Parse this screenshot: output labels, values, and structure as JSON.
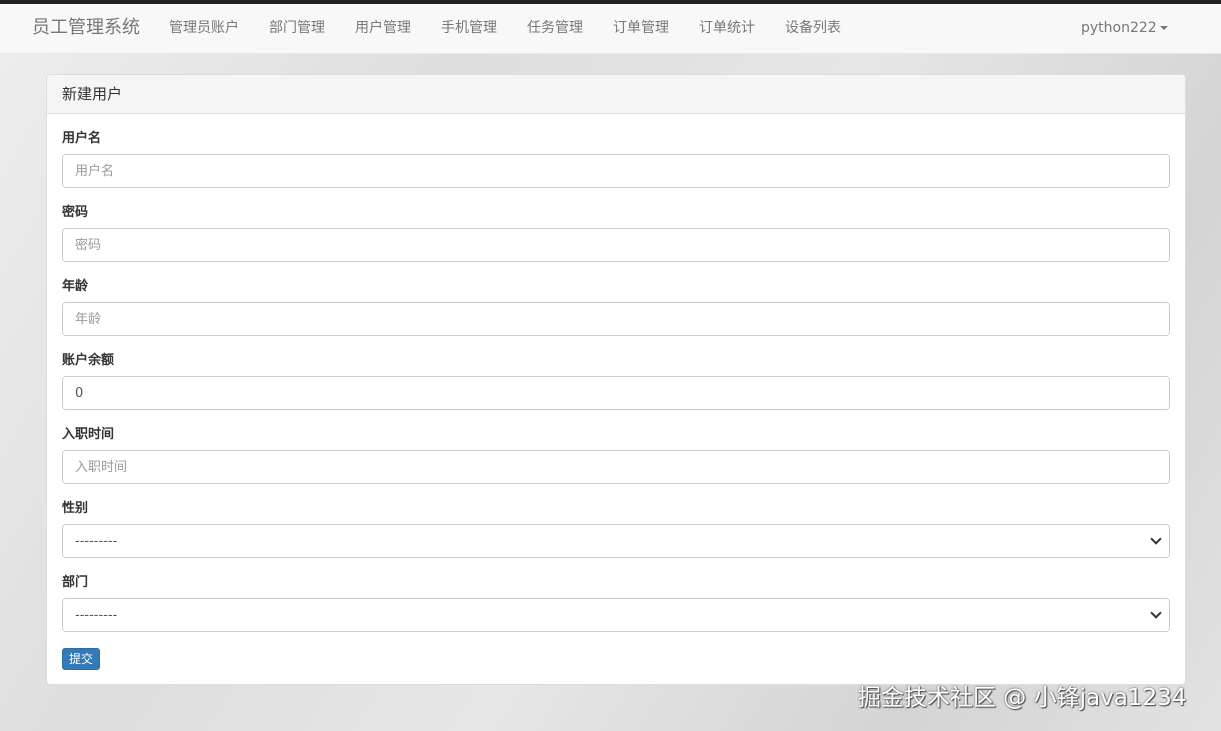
{
  "navbar": {
    "brand": "员工管理系统",
    "links": [
      "管理员账户",
      "部门管理",
      "用户管理",
      "手机管理",
      "任务管理",
      "订单管理",
      "订单统计",
      "设备列表"
    ],
    "user": "python222"
  },
  "panel": {
    "title": "新建用户"
  },
  "form": {
    "fields": [
      {
        "label": "用户名",
        "placeholder": "用户名",
        "value": ""
      },
      {
        "label": "密码",
        "placeholder": "密码",
        "value": ""
      },
      {
        "label": "年龄",
        "placeholder": "年龄",
        "value": ""
      },
      {
        "label": "账户余额",
        "placeholder": "",
        "value": "0"
      },
      {
        "label": "入职时间",
        "placeholder": "入职时间",
        "value": ""
      }
    ],
    "selects": [
      {
        "label": "性别",
        "selected": "---------"
      },
      {
        "label": "部门",
        "selected": "---------"
      }
    ],
    "submit_label": "提交"
  },
  "watermark": "掘金技术社区 @ 小锋java1234"
}
